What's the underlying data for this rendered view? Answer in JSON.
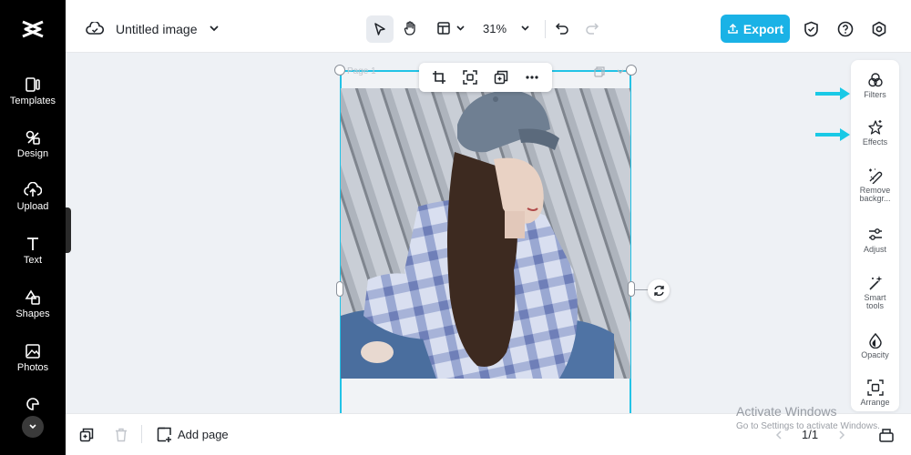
{
  "sidebar": {
    "logo": "capcut-logo",
    "items": [
      {
        "label": "Templates",
        "icon": "templates-icon"
      },
      {
        "label": "Design",
        "icon": "design-icon"
      },
      {
        "label": "Upload",
        "icon": "upload-icon"
      },
      {
        "label": "Text",
        "icon": "text-icon"
      },
      {
        "label": "Shapes",
        "icon": "shapes-icon"
      },
      {
        "label": "Photos",
        "icon": "photos-icon"
      }
    ]
  },
  "header": {
    "title": "Untitled image",
    "zoom": "31%",
    "export_label": "Export",
    "icons": [
      "cloud-icon",
      "chevron-down-icon",
      "select-pointer-icon",
      "hand-icon",
      "layout-icon",
      "undo-icon",
      "redo-icon",
      "shield-icon",
      "help-icon",
      "settings-icon"
    ]
  },
  "canvas": {
    "page_label": "Page 1",
    "toolbar_icons": [
      "crop-icon",
      "cutout-icon",
      "duplicate-icon",
      "more-icon"
    ]
  },
  "right_panel": {
    "items": [
      {
        "label": "Filters",
        "icon": "filters-icon"
      },
      {
        "label": "Effects",
        "icon": "effects-icon"
      },
      {
        "label": "Remove backgr...",
        "icon": "remove-background-icon"
      },
      {
        "label": "Adjust",
        "icon": "adjust-icon"
      },
      {
        "label": "Smart tools",
        "icon": "smart-tools-icon"
      },
      {
        "label": "Opacity",
        "icon": "opacity-icon"
      },
      {
        "label": "Arrange",
        "icon": "arrange-icon"
      }
    ]
  },
  "footer": {
    "add_page_label": "Add page",
    "pager": "1/1"
  },
  "watermark": {
    "title": "Activate Windows",
    "subtitle": "Go to Settings to activate Windows."
  },
  "colors": {
    "accent": "#1ab2e6",
    "selection": "#22c3e6",
    "annotation_arrow": "#19c9e6",
    "sidebar_bg": "#000000"
  }
}
